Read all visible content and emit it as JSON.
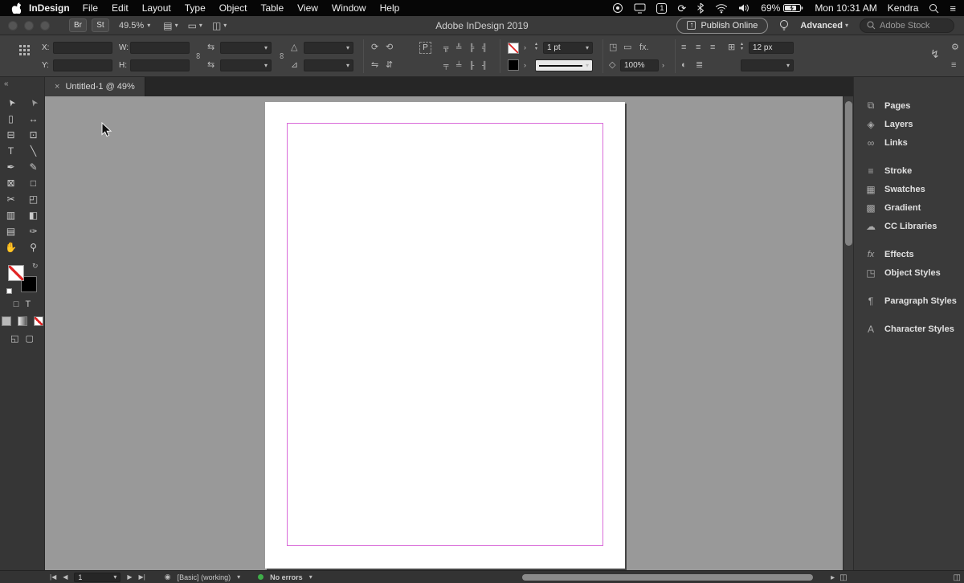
{
  "colors": {
    "menubar_bg": "#060606",
    "titlebar_bg": "#3a3a3a",
    "panel_bg": "#404040",
    "dock_bg": "#3a3a3a",
    "canvas_bg": "#999999",
    "page_bg": "#ffffff",
    "margin_guide": "#d96bd9",
    "no_error_green": "#3fae49"
  },
  "icons": {
    "chevron_down": "▾",
    "stepper_up": "▴",
    "stepper_down": "▾",
    "submenu_arrow": "›",
    "collapse": "«",
    "hamburger": "≡",
    "gear": "⚙",
    "lightning": "↯",
    "sync": "⟳",
    "rotate_cw": "⟳",
    "rotate_ccw": "⟲",
    "flip_h": "⇋",
    "flip_v": "⇵",
    "chain": "∞",
    "scale_arrows": "⇆",
    "rotate_tri": "△",
    "shear_tri": "⊿",
    "align_1": "╦",
    "align_2": "╩",
    "align_3": "╠",
    "align_4": "╣",
    "align_5": "╤",
    "align_6": "╧",
    "align_7": "╟",
    "align_8": "╢",
    "para_align": "≡",
    "corner_box": "◳",
    "rect": "▭",
    "diamond": "◇",
    "grid_box": "⊞",
    "half_circle": "◐",
    "lines": "≣",
    "view_options": "▤",
    "screen_mode": "▭",
    "arrange_docs": "◫",
    "upload_arrow": "↑",
    "swap": "↻",
    "container_glyph": "□",
    "text_glyph": "T",
    "normal_view_glyph": "◱",
    "screen_mode_glyph": "▢",
    "preflight_circle": "◉",
    "sb_icon_1": "▸",
    "sb_icon_2": "◫",
    "sb_icon_3": "◫"
  },
  "menubar": {
    "app_name": "InDesign",
    "menus": [
      "File",
      "Edit",
      "Layout",
      "Type",
      "Object",
      "Table",
      "View",
      "Window",
      "Help"
    ],
    "notification_count": "1",
    "battery_percent": "69%",
    "clock": "Mon 10:31 AM",
    "user_name": "Kendra"
  },
  "titlebar": {
    "window_title": "Adobe InDesign 2019",
    "bridge_button": "Br",
    "stock_button": "St",
    "zoom_level": "49.5%",
    "publish_button": "Publish Online",
    "workspace": "Advanced",
    "stock_search_placeholder": "Adobe Stock"
  },
  "control_panel": {
    "x_label": "X:",
    "x_value": "",
    "y_label": "Y:",
    "y_value": "",
    "w_label": "W:",
    "w_value": "",
    "h_label": "H:",
    "h_value": "",
    "scale_x_value": "",
    "scale_y_value": "",
    "rotation_value": "",
    "shear_value": "",
    "p_badge": "P",
    "stroke_weight": "1 pt",
    "fx_label": "fx.",
    "effect_opacity": "100%",
    "leading_value": "12 px",
    "empty_dropdown": ""
  },
  "tabbar": {
    "doc_tab": {
      "close": "×",
      "title": "Untitled-1 @ 49%"
    }
  },
  "toolbar": {
    "tools": [
      {
        "name": "selection-tool",
        "glyph": "➤"
      },
      {
        "name": "direct-selection-tool",
        "glyph": "➤"
      },
      {
        "name": "page-tool",
        "glyph": "▯"
      },
      {
        "name": "gap-tool",
        "glyph": "↔"
      },
      {
        "name": "content-collector-tool",
        "glyph": "⊟"
      },
      {
        "name": "content-placer-tool",
        "glyph": "⊡"
      },
      {
        "name": "type-tool",
        "glyph": "T"
      },
      {
        "name": "line-tool",
        "glyph": "╲"
      },
      {
        "name": "pen-tool",
        "glyph": "✒"
      },
      {
        "name": "pencil-tool",
        "glyph": "✎"
      },
      {
        "name": "rectangle-frame-tool",
        "glyph": "⊠"
      },
      {
        "name": "rectangle-tool",
        "glyph": "□"
      },
      {
        "name": "scissors-tool",
        "glyph": "✂"
      },
      {
        "name": "free-transform-tool",
        "glyph": "◰"
      },
      {
        "name": "gradient-swatch-tool",
        "glyph": "▥"
      },
      {
        "name": "gradient-feather-tool",
        "glyph": "◧"
      },
      {
        "name": "note-tool",
        "glyph": "▤"
      },
      {
        "name": "eyedropper-tool",
        "glyph": "✑"
      },
      {
        "name": "hand-tool",
        "glyph": "✋"
      },
      {
        "name": "zoom-tool",
        "glyph": "⚲"
      }
    ]
  },
  "dock": {
    "items": [
      {
        "name": "pages",
        "glyph": "⧉",
        "label": "Pages"
      },
      {
        "name": "layers",
        "glyph": "◈",
        "label": "Layers"
      },
      {
        "name": "links",
        "glyph": "∞",
        "label": "Links"
      },
      {
        "name": "stroke",
        "glyph": "≡",
        "label": "Stroke"
      },
      {
        "name": "swatches",
        "glyph": "▦",
        "label": "Swatches"
      },
      {
        "name": "gradient",
        "glyph": "▩",
        "label": "Gradient"
      },
      {
        "name": "cc-libraries",
        "glyph": "☁",
        "label": "CC Libraries"
      },
      {
        "name": "effects",
        "glyph": "fx",
        "label": "Effects"
      },
      {
        "name": "object-styles",
        "glyph": "◳",
        "label": "Object Styles"
      },
      {
        "name": "paragraph-styles",
        "glyph": "¶",
        "label": "Paragraph Styles"
      },
      {
        "name": "character-styles",
        "glyph": "A",
        "label": "Character Styles"
      }
    ]
  },
  "statusbar": {
    "first_page": "|◀",
    "prev_page": "◀",
    "page_number": "1",
    "next_page": "▶",
    "last_page": "▶|",
    "preflight_profile": "[Basic] (working)",
    "error_status": "No errors"
  }
}
